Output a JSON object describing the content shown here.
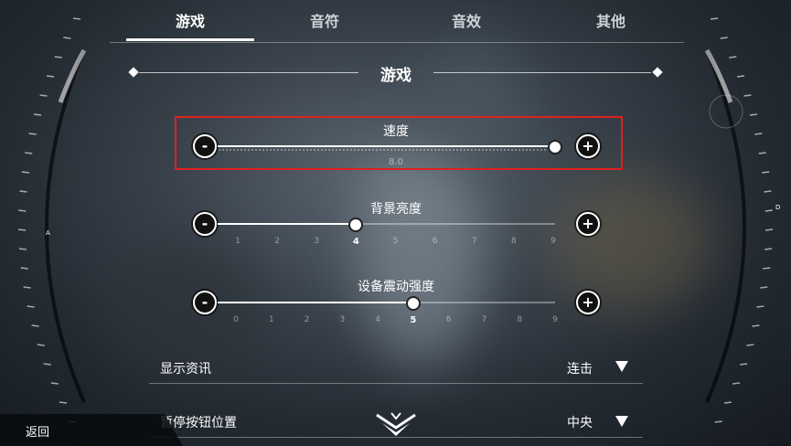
{
  "tabs": [
    {
      "label": "游戏",
      "active": true
    },
    {
      "label": "音符",
      "active": false
    },
    {
      "label": "音效",
      "active": false
    },
    {
      "label": "其他",
      "active": false
    }
  ],
  "section_title": "游戏",
  "sliders": {
    "speed": {
      "label": "速度",
      "value_text": "8.0",
      "fraction": 1.0,
      "minus": "-",
      "plus": "+"
    },
    "bg_brightness": {
      "label": "背景亮度",
      "value": 4,
      "ticks": [
        "1",
        "2",
        "3",
        "4",
        "5",
        "6",
        "7",
        "8",
        "9"
      ],
      "minus": "-",
      "plus": "+"
    },
    "vibration": {
      "label": "设备震动强度",
      "value": 5,
      "ticks": [
        "0",
        "1",
        "2",
        "3",
        "4",
        "5",
        "6",
        "7",
        "8",
        "9"
      ],
      "minus": "-",
      "plus": "+"
    }
  },
  "settings": {
    "show_info": {
      "label": "显示资讯",
      "value": "连击"
    },
    "pause_button": {
      "label": "暂停按钮位置",
      "value": "中央"
    }
  },
  "gauge": {
    "left_letter": "A",
    "right_letter": "D"
  },
  "back_label": "返回",
  "colors": {
    "highlight": "#e02020",
    "accent": "#ffffff"
  }
}
